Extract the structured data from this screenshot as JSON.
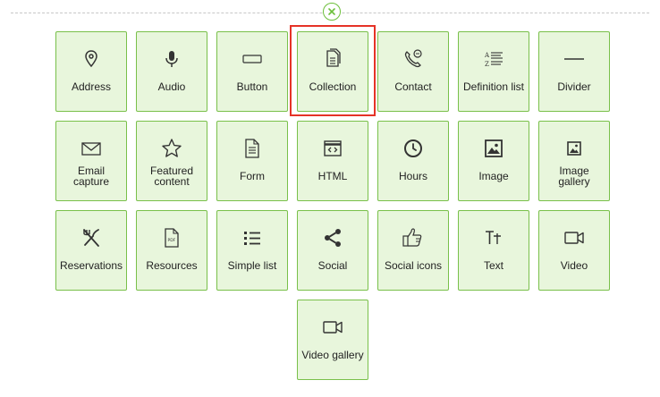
{
  "close_icon": "close-circle-icon",
  "accent_color": "#79c04a",
  "highlight_color": "#e53327",
  "tiles": [
    {
      "label": "Address",
      "icon": "map-pin-icon"
    },
    {
      "label": "Audio",
      "icon": "microphone-icon"
    },
    {
      "label": "Button",
      "icon": "button-icon"
    },
    {
      "label": "Collection",
      "icon": "collection-icon"
    },
    {
      "label": "Contact",
      "icon": "phone-chat-icon"
    },
    {
      "label": "Definition list",
      "icon": "definition-list-icon"
    },
    {
      "label": "Divider",
      "icon": "divider-icon"
    },
    {
      "label": "Email capture",
      "icon": "envelope-icon"
    },
    {
      "label": "Featured content",
      "icon": "star-icon"
    },
    {
      "label": "Form",
      "icon": "form-icon"
    },
    {
      "label": "HTML",
      "icon": "code-icon"
    },
    {
      "label": "Hours",
      "icon": "clock-icon"
    },
    {
      "label": "Image",
      "icon": "image-icon"
    },
    {
      "label": "Image gallery",
      "icon": "image-gallery-icon"
    },
    {
      "label": "Reservations",
      "icon": "fork-knife-icon"
    },
    {
      "label": "Resources",
      "icon": "pdf-file-icon"
    },
    {
      "label": "Simple list",
      "icon": "list-icon"
    },
    {
      "label": "Social",
      "icon": "share-icon"
    },
    {
      "label": "Social icons",
      "icon": "thumbs-up-icon"
    },
    {
      "label": "Text",
      "icon": "text-icon"
    },
    {
      "label": "Video",
      "icon": "video-camera-icon"
    },
    {
      "label": "Video gallery",
      "icon": "video-gallery-icon"
    }
  ]
}
